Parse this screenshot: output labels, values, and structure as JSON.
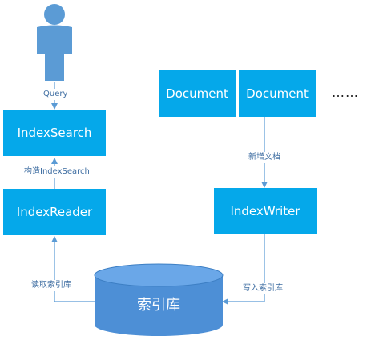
{
  "nodes": {
    "index_search": "IndexSearch",
    "index_reader": "IndexReader",
    "index_writer": "IndexWriter",
    "document_1": "Document",
    "document_2": "Document",
    "more_documents": "……",
    "index_store": "索引库"
  },
  "edges": {
    "user_to_search": "Query",
    "reader_to_search": "构造IndexSearch",
    "store_to_reader": "读取索引库",
    "document_to_writer": "新增文档",
    "writer_to_store": "写入索引库"
  },
  "icons": {
    "user": "user-icon"
  },
  "colors": {
    "box": "#05a8ea",
    "cylinder": "#4d8fd6",
    "arrow": "#5b9bd5",
    "label_text": "#3f6ea2"
  }
}
